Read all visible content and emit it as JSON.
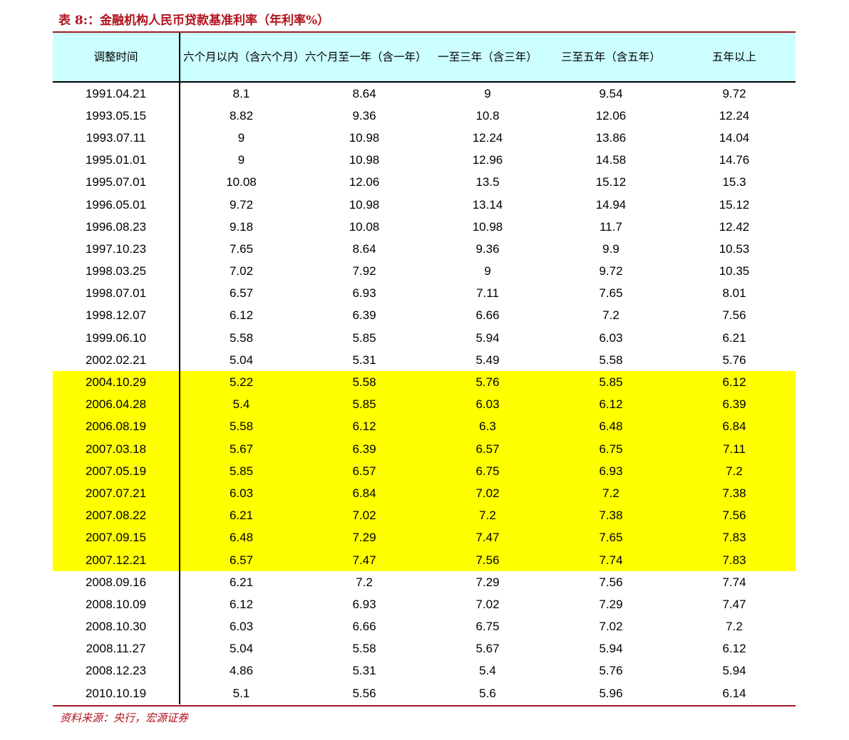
{
  "title": "表 8:：金融机构人民币贷款基准利率（年利率%）",
  "source": "资料来源：央行，宏源证券",
  "colors": {
    "title_red": "#b0121b",
    "header_bg": "#ccffff",
    "highlight_bg": "#ffff00"
  },
  "table": {
    "headers": [
      "调整时间",
      "六个月以内（含六个月）",
      "六个月至一年（含一年）",
      "一至三年（含三年）",
      "三至五年（含五年）",
      "五年以上"
    ],
    "highlighted_rows": [
      "2004.10.29",
      "2006.04.28",
      "2006.08.19",
      "2007.03.18",
      "2007.05.19",
      "2007.07.21",
      "2007.08.22",
      "2007.09.15",
      "2007.12.21"
    ],
    "rows": [
      [
        "1991.04.21",
        "8.1",
        "8.64",
        "9",
        "9.54",
        "9.72"
      ],
      [
        "1993.05.15",
        "8.82",
        "9.36",
        "10.8",
        "12.06",
        "12.24"
      ],
      [
        "1993.07.11",
        "9",
        "10.98",
        "12.24",
        "13.86",
        "14.04"
      ],
      [
        "1995.01.01",
        "9",
        "10.98",
        "12.96",
        "14.58",
        "14.76"
      ],
      [
        "1995.07.01",
        "10.08",
        "12.06",
        "13.5",
        "15.12",
        "15.3"
      ],
      [
        "1996.05.01",
        "9.72",
        "10.98",
        "13.14",
        "14.94",
        "15.12"
      ],
      [
        "1996.08.23",
        "9.18",
        "10.08",
        "10.98",
        "11.7",
        "12.42"
      ],
      [
        "1997.10.23",
        "7.65",
        "8.64",
        "9.36",
        "9.9",
        "10.53"
      ],
      [
        "1998.03.25",
        "7.02",
        "7.92",
        "9",
        "9.72",
        "10.35"
      ],
      [
        "1998.07.01",
        "6.57",
        "6.93",
        "7.11",
        "7.65",
        "8.01"
      ],
      [
        "1998.12.07",
        "6.12",
        "6.39",
        "6.66",
        "7.2",
        "7.56"
      ],
      [
        "1999.06.10",
        "5.58",
        "5.85",
        "5.94",
        "6.03",
        "6.21"
      ],
      [
        "2002.02.21",
        "5.04",
        "5.31",
        "5.49",
        "5.58",
        "5.76"
      ],
      [
        "2004.10.29",
        "5.22",
        "5.58",
        "5.76",
        "5.85",
        "6.12"
      ],
      [
        "2006.04.28",
        "5.4",
        "5.85",
        "6.03",
        "6.12",
        "6.39"
      ],
      [
        "2006.08.19",
        "5.58",
        "6.12",
        "6.3",
        "6.48",
        "6.84"
      ],
      [
        "2007.03.18",
        "5.67",
        "6.39",
        "6.57",
        "6.75",
        "7.11"
      ],
      [
        "2007.05.19",
        "5.85",
        "6.57",
        "6.75",
        "6.93",
        "7.2"
      ],
      [
        "2007.07.21",
        "6.03",
        "6.84",
        "7.02",
        "7.2",
        "7.38"
      ],
      [
        "2007.08.22",
        "6.21",
        "7.02",
        "7.2",
        "7.38",
        "7.56"
      ],
      [
        "2007.09.15",
        "6.48",
        "7.29",
        "7.47",
        "7.65",
        "7.83"
      ],
      [
        "2007.12.21",
        "6.57",
        "7.47",
        "7.56",
        "7.74",
        "7.83"
      ],
      [
        "2008.09.16",
        "6.21",
        "7.2",
        "7.29",
        "7.56",
        "7.74"
      ],
      [
        "2008.10.09",
        "6.12",
        "6.93",
        "7.02",
        "7.29",
        "7.47"
      ],
      [
        "2008.10.30",
        "6.03",
        "6.66",
        "6.75",
        "7.02",
        "7.2"
      ],
      [
        "2008.11.27",
        "5.04",
        "5.58",
        "5.67",
        "5.94",
        "6.12"
      ],
      [
        "2008.12.23",
        "4.86",
        "5.31",
        "5.4",
        "5.76",
        "5.94"
      ],
      [
        "2010.10.19",
        "5.1",
        "5.56",
        "5.6",
        "5.96",
        "6.14"
      ]
    ]
  }
}
